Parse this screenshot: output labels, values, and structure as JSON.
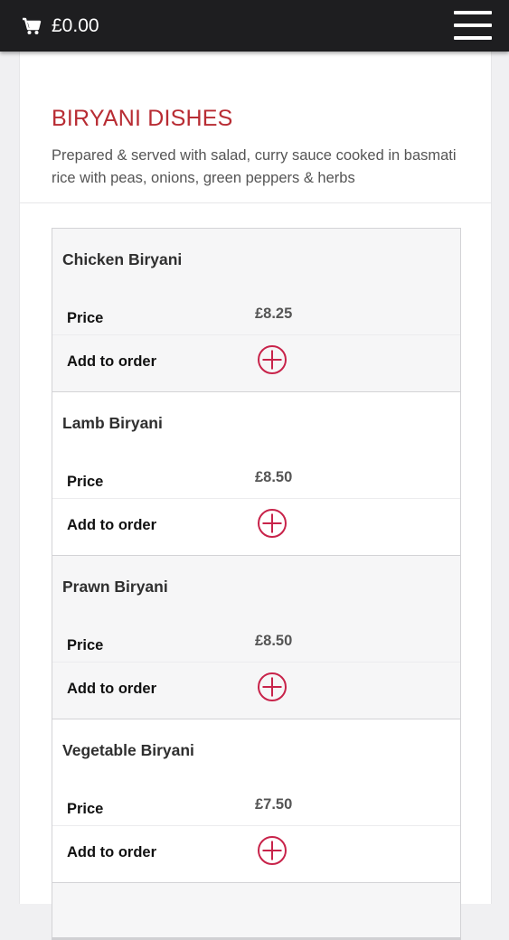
{
  "header": {
    "cart_total": "£0.00",
    "cart_icon": "shopping-cart-icon",
    "menu_icon": "hamburger-menu-icon"
  },
  "section": {
    "title": "BIRYANI DISHES",
    "description": "Prepared & served with salad, curry sauce cooked in basmati rice with peas, onions, green peppers & herbs"
  },
  "labels": {
    "price": "Price",
    "add_to_order": "Add to order"
  },
  "dishes": [
    {
      "name": "Chicken Biryani",
      "price": "£8.25"
    },
    {
      "name": "Lamb Biryani",
      "price": "£8.50"
    },
    {
      "name": "Prawn Biryani",
      "price": "£8.50"
    },
    {
      "name": "Vegetable Biryani",
      "price": "£7.50"
    }
  ],
  "colors": {
    "accent": "#b82c33",
    "topbar": "#1e1e20",
    "add_icon": "#c8234a"
  }
}
